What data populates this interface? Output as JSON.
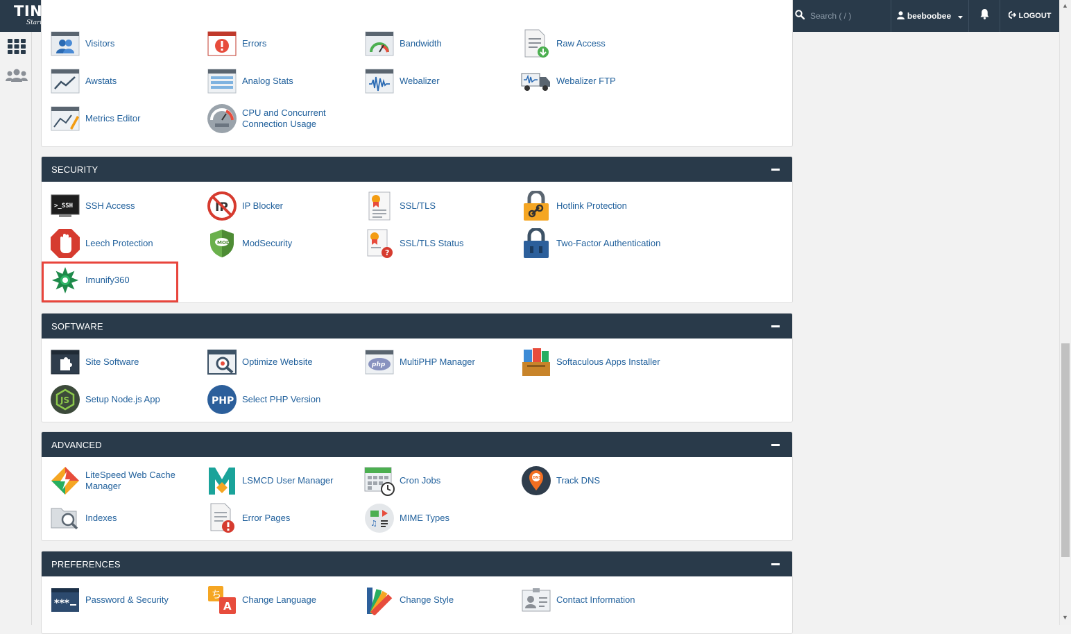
{
  "brand": {
    "name": "TINOHOST",
    "tagline": "Start Your Business"
  },
  "topbar": {
    "search_placeholder": "Search ( / )",
    "username": "beeboobee",
    "logout_label": "LOGOUT"
  },
  "metrics": {
    "items": [
      {
        "label": "Visitors",
        "icon": "visitors-icon"
      },
      {
        "label": "Errors",
        "icon": "errors-icon"
      },
      {
        "label": "Bandwidth",
        "icon": "bandwidth-icon"
      },
      {
        "label": "Raw Access",
        "icon": "raw-access-icon"
      },
      {
        "label": "Awstats",
        "icon": "awstats-icon"
      },
      {
        "label": "Analog Stats",
        "icon": "analog-stats-icon"
      },
      {
        "label": "Webalizer",
        "icon": "webalizer-icon"
      },
      {
        "label": "Webalizer FTP",
        "icon": "webalizer-ftp-icon"
      },
      {
        "label": "Metrics Editor",
        "icon": "metrics-editor-icon"
      },
      {
        "label": "CPU and Concurrent Connection Usage",
        "icon": "cpu-usage-icon"
      }
    ]
  },
  "security": {
    "title": "SECURITY",
    "items": [
      {
        "label": "SSH Access",
        "icon": "ssh-icon"
      },
      {
        "label": "IP Blocker",
        "icon": "ip-blocker-icon"
      },
      {
        "label": "SSL/TLS",
        "icon": "ssl-certificate-icon"
      },
      {
        "label": "Hotlink Protection",
        "icon": "hotlink-lock-icon"
      },
      {
        "label": "Leech Protection",
        "icon": "leech-hand-icon"
      },
      {
        "label": "ModSecurity",
        "icon": "modsecurity-shield-icon"
      },
      {
        "label": "SSL/TLS Status",
        "icon": "ssl-status-icon"
      },
      {
        "label": "Two-Factor Authentication",
        "icon": "two-factor-lock-icon"
      },
      {
        "label": "Imunify360",
        "icon": "imunify360-icon"
      }
    ]
  },
  "software": {
    "title": "SOFTWARE",
    "items": [
      {
        "label": "Site Software",
        "icon": "puzzle-icon"
      },
      {
        "label": "Optimize Website",
        "icon": "optimize-icon"
      },
      {
        "label": "MultiPHP Manager",
        "icon": "multiphp-icon"
      },
      {
        "label": "Softaculous Apps Installer",
        "icon": "softaculous-icon"
      },
      {
        "label": "Setup Node.js App",
        "icon": "nodejs-icon"
      },
      {
        "label": "Select PHP Version",
        "icon": "php-icon"
      }
    ]
  },
  "advanced": {
    "title": "ADVANCED",
    "items": [
      {
        "label": "LiteSpeed Web Cache Manager",
        "icon": "litespeed-icon"
      },
      {
        "label": "LSMCD User Manager",
        "icon": "lsmcd-icon"
      },
      {
        "label": "Cron Jobs",
        "icon": "cron-calendar-icon"
      },
      {
        "label": "Track DNS",
        "icon": "dns-pin-icon"
      },
      {
        "label": "Indexes",
        "icon": "indexes-folder-icon"
      },
      {
        "label": "Error Pages",
        "icon": "error-pages-icon"
      },
      {
        "label": "MIME Types",
        "icon": "mime-types-icon"
      }
    ]
  },
  "preferences": {
    "title": "PREFERENCES",
    "items": [
      {
        "label": "Password & Security",
        "icon": "password-icon"
      },
      {
        "label": "Change Language",
        "icon": "language-icon"
      },
      {
        "label": "Change Style",
        "icon": "style-swatch-icon"
      },
      {
        "label": "Contact Information",
        "icon": "contact-card-icon"
      }
    ]
  }
}
